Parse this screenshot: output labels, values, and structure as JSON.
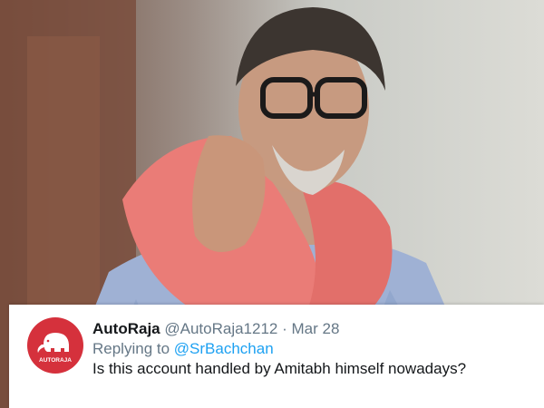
{
  "colors": {
    "accent_link": "#1da1f2",
    "avatar_bg": "#d5313c",
    "secondary_text": "#657786",
    "primary_text": "#14171a"
  },
  "photo": {
    "icon": "person-photo"
  },
  "tweet": {
    "avatar_logo_text": "AUTORAJA",
    "display_name": "AutoRaja",
    "handle": "@AutoRaja1212",
    "separator": "·",
    "date": "Mar 28",
    "replying_prefix": "Replying to",
    "replying_to": "@SrBachchan",
    "text": "Is this account handled by Amitabh himself nowadays?"
  }
}
